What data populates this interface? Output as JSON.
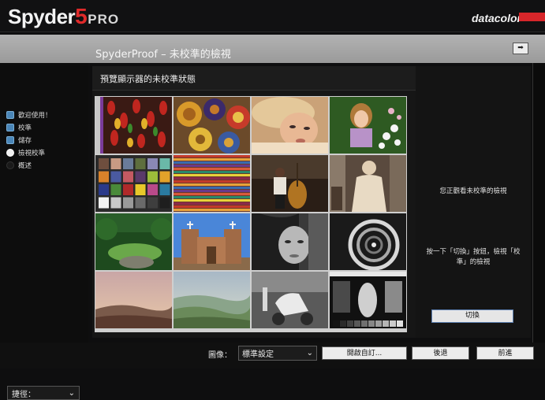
{
  "app": {
    "logo_main": "Spyder",
    "logo_num": "5",
    "logo_suffix": "PRO",
    "brand": "datacolor",
    "brand_color": "#d7262a"
  },
  "window": {
    "title": "SpyderProof – 未校準的檢視",
    "collapse_icon": "arrow-right-icon"
  },
  "sidebar": {
    "steps": [
      {
        "label": "歡迎使用！",
        "state": "done"
      },
      {
        "label": "校準",
        "state": "done"
      },
      {
        "label": "儲存",
        "state": "done"
      },
      {
        "label": "檢視校準",
        "state": "active"
      },
      {
        "label": "概述",
        "state": "todo"
      }
    ],
    "shortcut_label": "捷徑："
  },
  "panel": {
    "header": "預覽顯示器的未校準狀態",
    "viewing_text": "您正觀看未校準的檢視",
    "instruction_text": "按一下「切換」按鈕，檢視「校準」的檢視",
    "switch_button": "切換"
  },
  "bottom": {
    "image_label": "圖像：",
    "image_select": "標準設定",
    "custom_button": "開啟自訂...",
    "back_button": "後退",
    "next_button": "前進"
  }
}
